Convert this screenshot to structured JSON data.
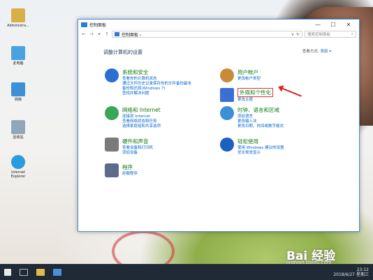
{
  "desktop": {
    "icons": [
      {
        "label": "Administra...",
        "icon": "user-folder-icon",
        "color": "#d8b04a"
      },
      {
        "label": "此电脑",
        "icon": "computer-icon",
        "color": "#4aa3e0"
      },
      {
        "label": "网络",
        "icon": "network-icon",
        "color": "#3d8fd6"
      },
      {
        "label": "回收站",
        "icon": "recycle-bin-icon",
        "color": "#8fa7b8"
      },
      {
        "label": "Internet Explorer",
        "icon": "ie-icon",
        "color": "#2b9be0"
      }
    ],
    "watermark_main": "Bai 经验",
    "watermark_sub": "jingyan.baidu.com"
  },
  "window": {
    "title": "控制面板",
    "address": "控制面板 ›",
    "search_placeholder": "搜索控制面板",
    "heading": "调整计算机的设置",
    "view_by_label": "查看方式:",
    "view_by_value": "类别 ▾",
    "categories": [
      {
        "title": "系统和安全",
        "icon": "shield-icon",
        "color": "#2b6fd0",
        "links": [
          "查看你的计算机状态",
          "通过文件历史记录保存你的文件备份副本",
          "备份和还原(Windows 7)",
          "查找并解决问题"
        ]
      },
      {
        "title": "网络和 Internet",
        "icon": "globe-icon",
        "color": "#3aa757",
        "links": [
          "连接到 Internet",
          "查看网络状态和任务",
          "选择家庭组和共享选项"
        ]
      },
      {
        "title": "硬件和声音",
        "icon": "printer-icon",
        "color": "#7a7a7a",
        "links": [
          "查看设备和打印机",
          "添加设备"
        ]
      },
      {
        "title": "程序",
        "icon": "programs-icon",
        "color": "#5a6c8a",
        "links": [
          "卸载程序"
        ]
      },
      {
        "title": "用户帐户",
        "icon": "users-icon",
        "color": "#c98a3a",
        "links": [
          "更改帐户类型"
        ]
      },
      {
        "title": "外观和个性化",
        "icon": "appearance-icon",
        "color": "#3b6fd6",
        "links": [
          "更改主题"
        ]
      },
      {
        "title": "时钟、语言和区域",
        "icon": "clock-icon",
        "color": "#3d8fd6",
        "links": [
          "添加语言",
          "更改输入法",
          "更改日期、时间或数字格式"
        ]
      },
      {
        "title": "轻松使用",
        "icon": "accessibility-icon",
        "color": "#1f5fbf",
        "links": [
          "使用 Windows 建议的设置",
          "优化视觉显示"
        ]
      }
    ]
  },
  "taskbar": {
    "time": "23:12",
    "date": "2018/6/27 星期三"
  }
}
